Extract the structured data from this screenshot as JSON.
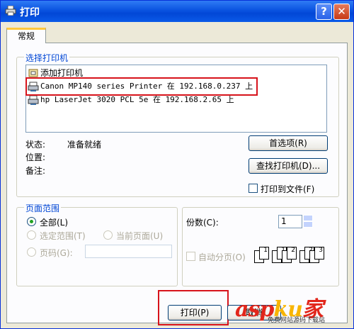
{
  "window": {
    "title": "打印",
    "help_label": "?",
    "close_label": "✕"
  },
  "tabs": [
    {
      "label": "常规"
    }
  ],
  "select_printer": {
    "group_label": "选择打印机",
    "items": [
      {
        "label": "添加打印机",
        "icon": "add-printer-icon"
      },
      {
        "label": "Canon MP140 series Printer 在 192.168.0.237 上",
        "icon": "network-printer-icon",
        "selected": true
      },
      {
        "label": "hp LaserJet 3020 PCL 5e 在 192.168.2.65 上",
        "icon": "network-printer-icon"
      }
    ],
    "status_label": "状态:",
    "status_value": "准备就绪",
    "location_label": "位置:",
    "comment_label": "备注:",
    "preferences_button": "首选项(R)",
    "find_printer_button": "查找打印机(D)...",
    "print_to_file_label": "打印到文件(F)"
  },
  "page_range": {
    "group_label": "页面范围",
    "all_label": "全部(L)",
    "selection_label": "选定范围(T)",
    "current_page_label": "当前页面(U)",
    "pages_label": "页码(G):",
    "pages_value": ""
  },
  "copies": {
    "label": "份数(C):",
    "value": "1",
    "collate_label": "自动分页(O)"
  },
  "footer": {
    "print_button": "打印(P)",
    "cancel_button": "取消"
  },
  "watermark": {
    "brand_a": "asp",
    "brand_b": "ku",
    "brand_c": "家",
    "tagline": "免费网站源码下载站"
  }
}
